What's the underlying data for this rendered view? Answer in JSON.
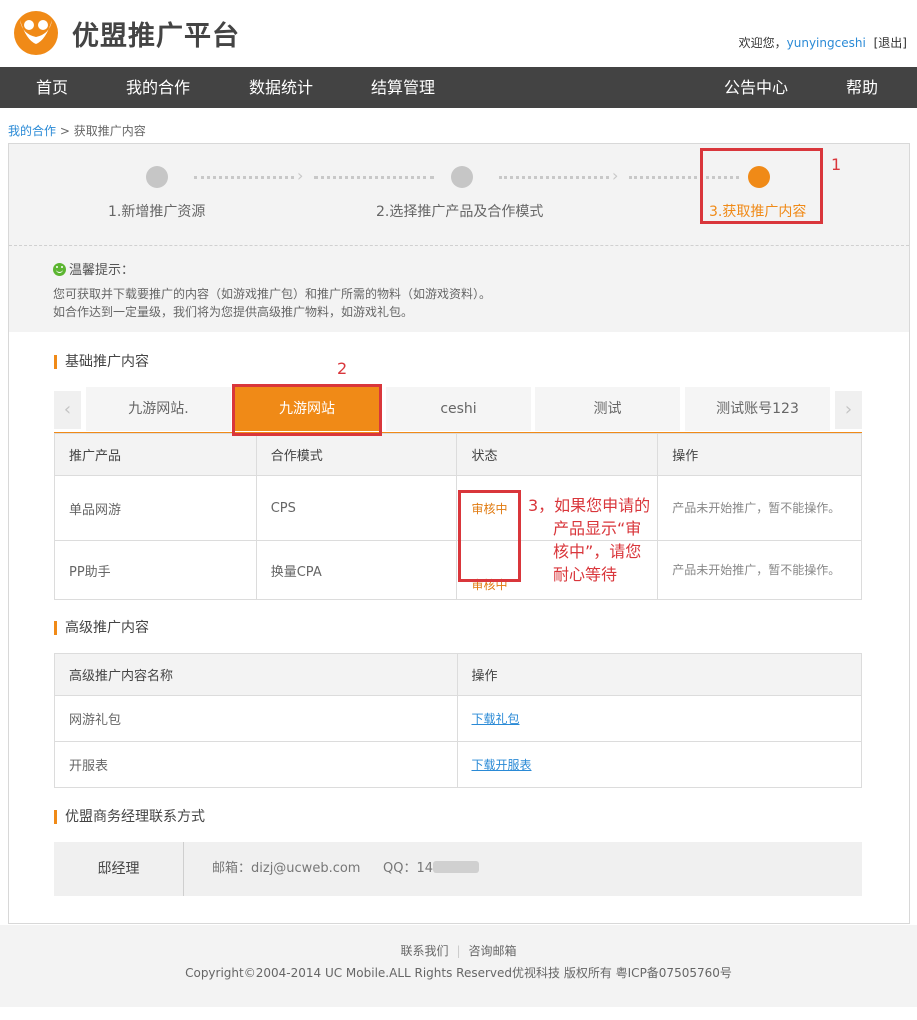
{
  "header": {
    "logo_text": "优盟推广平台",
    "welcome_prefix": "欢迎您，",
    "username": "yunyingceshi",
    "logout": "[退出]"
  },
  "nav": {
    "items": [
      "首页",
      "我的合作",
      "数据统计",
      "结算管理",
      "公告中心",
      "帮助"
    ]
  },
  "breadcrumb": {
    "link": "我的合作",
    "separator": " > ",
    "current": "获取推广内容"
  },
  "steps": [
    {
      "label": "1.新增推广资源",
      "active": false
    },
    {
      "label": "2.选择推广产品及合作模式",
      "active": false
    },
    {
      "label": "3.获取推广内容",
      "active": true
    }
  ],
  "tips": {
    "title": "温馨提示：",
    "line1": "您可获取并下载要推广的内容（如游戏推广包）和推广所需的物料（如游戏资料）。",
    "line2": "如合作达到一定量级，我们将为您提供高级推广物料，如游戏礼包。"
  },
  "basic": {
    "title": "基础推广内容",
    "prev": "‹",
    "next": "›",
    "tabs": [
      "九游网站.",
      "九游网站",
      "ceshi",
      "测试",
      "测试账号123"
    ],
    "headers": [
      "推广产品",
      "合作模式",
      "状态",
      "操作"
    ],
    "rows": [
      {
        "product": "单品网游",
        "mode": "CPS",
        "status": "审核中",
        "op": "产品未开始推广，暂不能操作。"
      },
      {
        "product": "PP助手",
        "mode": "换量CPA",
        "status": "审核中",
        "op": "产品未开始推广，暂不能操作。"
      }
    ]
  },
  "advanced": {
    "title": "高级推广内容",
    "headers": [
      "高级推广内容名称",
      "操作"
    ],
    "rows": [
      {
        "name": "网游礼包",
        "action": "下载礼包"
      },
      {
        "name": "开服表",
        "action": "下载开服表"
      }
    ]
  },
  "contact": {
    "title": "优盟商务经理联系方式",
    "name": "邸经理",
    "email": "邮箱：dizj@ucweb.com",
    "qq": "QQ：14"
  },
  "annotations": {
    "n1": "1",
    "n2": "2",
    "n3_line1": "3，如果您申请的",
    "n3_line2": "产品显示“审",
    "n3_line3": "核中”，请您",
    "n3_line4": "耐心等待"
  },
  "footer": {
    "link1": "联系我们",
    "sep": "|",
    "link2": "咨询邮箱",
    "copyright": "Copyright©2004-2014 UC Mobile.ALL Rights Reserved优视科技 版权所有 粤ICP备07505760号"
  },
  "colors": {
    "accent": "#f08a17",
    "nav_bg": "#434343",
    "link": "#2a8ad6",
    "annotation": "#d9363b"
  }
}
